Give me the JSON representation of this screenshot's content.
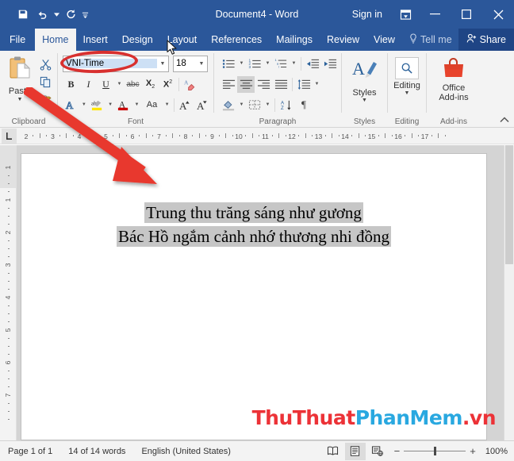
{
  "titlebar": {
    "document_title": "Document4  -  Word",
    "signin_label": "Sign in",
    "qat": [
      {
        "name": "save-icon",
        "label": "Save"
      },
      {
        "name": "undo-icon",
        "label": "Undo"
      },
      {
        "name": "redo-icon",
        "label": "Redo"
      },
      {
        "name": "customize-qat-icon",
        "label": "Customize Quick Access Toolbar"
      }
    ],
    "window_controls": [
      {
        "name": "ribbon-display-options-icon",
        "label": "Ribbon Display Options"
      },
      {
        "name": "minimize-icon",
        "label": "Minimize"
      },
      {
        "name": "maximize-icon",
        "label": "Maximize"
      },
      {
        "name": "close-icon",
        "label": "Close"
      }
    ],
    "bg_color": "#2b579a"
  },
  "tabs": {
    "items": [
      {
        "label": "File",
        "active": false
      },
      {
        "label": "Home",
        "active": true
      },
      {
        "label": "Insert",
        "active": false
      },
      {
        "label": "Design",
        "active": false
      },
      {
        "label": "Layout",
        "active": false
      },
      {
        "label": "References",
        "active": false
      },
      {
        "label": "Mailings",
        "active": false
      },
      {
        "label": "Review",
        "active": false
      },
      {
        "label": "View",
        "active": false
      }
    ],
    "tell_me": "Tell me",
    "share": "Share"
  },
  "ribbon": {
    "clipboard": {
      "group_label": "Clipboard",
      "paste_label": "Paste",
      "items": [
        "cut-icon",
        "copy-icon",
        "format-painter-icon"
      ]
    },
    "font": {
      "group_label": "Font",
      "font_name": "VNI-Time",
      "font_size": "18",
      "buttons": [
        "bold",
        "italic",
        "underline",
        "strikethrough",
        "subscript",
        "superscript",
        "clear-formatting",
        "text-effects",
        "text-highlight",
        "font-color",
        "change-case",
        "grow-font",
        "shrink-font"
      ]
    },
    "paragraph": {
      "group_label": "Paragraph",
      "buttons": [
        "bullets",
        "numbering",
        "multilevel-list",
        "decrease-indent",
        "increase-indent",
        "align-left",
        "align-center",
        "align-right",
        "justify",
        "line-spacing",
        "shading",
        "borders",
        "sort",
        "show-formatting-marks"
      ],
      "active_alignment": "align-center"
    },
    "styles": {
      "group_label": "Styles",
      "button_label": "Styles"
    },
    "editing": {
      "group_label": "Editing",
      "button_label": "Editing"
    },
    "addins": {
      "group_label": "Add-ins",
      "button_label_line1": "Office",
      "button_label_line2": "Add-ins"
    }
  },
  "ruler": {
    "horizontal_ticks": [
      "2",
      "3",
      "4",
      "5",
      "6",
      "7",
      "8",
      "9",
      "10",
      "11",
      "12",
      "13",
      "14",
      "15",
      "16",
      "17"
    ],
    "vertical_ticks": [
      "1",
      "1",
      "2",
      "3",
      "4",
      "5",
      "6",
      "7"
    ],
    "tab_stop_icon": "left-tab-stop-icon"
  },
  "document": {
    "lines": [
      "Trung thu trăng sáng như gương",
      "Bác Hồ ngắm cảnh nhớ thương nhi đồng"
    ],
    "selection_color": "#c6c6c6"
  },
  "watermark": {
    "part1": "ThuThuat",
    "part2": "PhanMem",
    "part3": ".vn",
    "color1": "#ec3237",
    "color2": "#29a8e0"
  },
  "statusbar": {
    "page": "Page 1 of 1",
    "words": "14 of 14 words",
    "language": "English (United States)",
    "views": [
      {
        "name": "read-mode-icon",
        "active": false
      },
      {
        "name": "print-layout-icon",
        "active": true
      },
      {
        "name": "web-layout-icon",
        "active": false
      }
    ],
    "zoom_out": "−",
    "zoom_in": "+",
    "zoom_level": "100%"
  },
  "annotations": {
    "ellipse_target": "font-name-combo",
    "arrow_target": "document-text",
    "color": "#d8302f"
  }
}
